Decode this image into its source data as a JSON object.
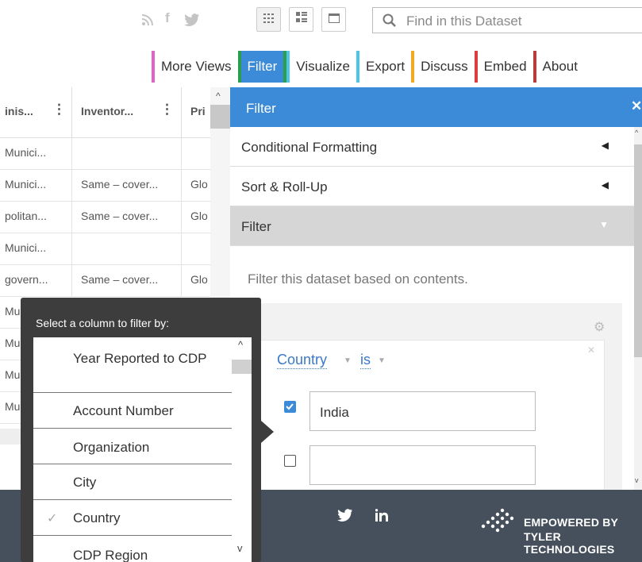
{
  "search": {
    "placeholder": "Find in this Dataset"
  },
  "social": {
    "rss": "rss-icon",
    "facebook": "f",
    "twitter": "twitter-icon"
  },
  "view_buttons": [
    "grid-view-icon",
    "list-view-icon",
    "single-row-view-icon"
  ],
  "tabs": [
    {
      "label": "More Views",
      "color": "#e063c8"
    },
    {
      "label": "Filter",
      "color": "#2b9e4c",
      "active": true
    },
    {
      "label": "Visualize",
      "color": "#4cc6e8"
    },
    {
      "label": "Export",
      "color": "#f5a623"
    },
    {
      "label": "Discuss",
      "color": "#e03c3c"
    },
    {
      "label": "Embed",
      "color": "#b83c3c"
    },
    {
      "label": "About",
      "color": "#888888"
    }
  ],
  "grid": {
    "columns": [
      "inis...",
      "Inventor...",
      "Pri"
    ],
    "rows": [
      [
        "Munici...",
        "",
        ""
      ],
      [
        "Munici...",
        "Same – cover...",
        "Glo"
      ],
      [
        "politan...",
        "Same – cover...",
        "Glo"
      ],
      [
        "Munici...",
        "",
        ""
      ],
      [
        "govern...",
        "Same – cover...",
        "Glo"
      ],
      [
        "Mu",
        "",
        ""
      ],
      [
        "Mu",
        "",
        ""
      ],
      [
        "Mu",
        "",
        ""
      ],
      [
        "Mu",
        "",
        ""
      ]
    ]
  },
  "panel": {
    "title": "Filter",
    "sections": [
      {
        "label": "Conditional Formatting",
        "state": "collapsed"
      },
      {
        "label": "Sort & Roll-Up",
        "state": "collapsed"
      },
      {
        "label": "Filter",
        "state": "expanded"
      }
    ],
    "description": "Filter this dataset based on contents.",
    "filter": {
      "column": "Country",
      "operator": "is",
      "values": [
        {
          "text": "India",
          "checked": true
        },
        {
          "text": "",
          "checked": false
        }
      ]
    }
  },
  "column_popup": {
    "title": "Select a column to filter by:",
    "items": [
      {
        "label": "Year Reported to CDP",
        "checked": false
      },
      {
        "label": "Account Number",
        "checked": false
      },
      {
        "label": "Organization",
        "checked": false
      },
      {
        "label": "City",
        "checked": false
      },
      {
        "label": "Country",
        "checked": true
      },
      {
        "label": "CDP Region",
        "checked": false
      }
    ]
  },
  "footer": {
    "social": [
      "twitter-icon",
      "linkedin-icon"
    ],
    "brand_line1": "EMPOWERED BY",
    "brand_line2": "TYLER TECHNOLOGIES"
  },
  "colors": {
    "accent": "#3c8bd9",
    "footer": "#46505c",
    "popup": "#3d3d3d"
  }
}
